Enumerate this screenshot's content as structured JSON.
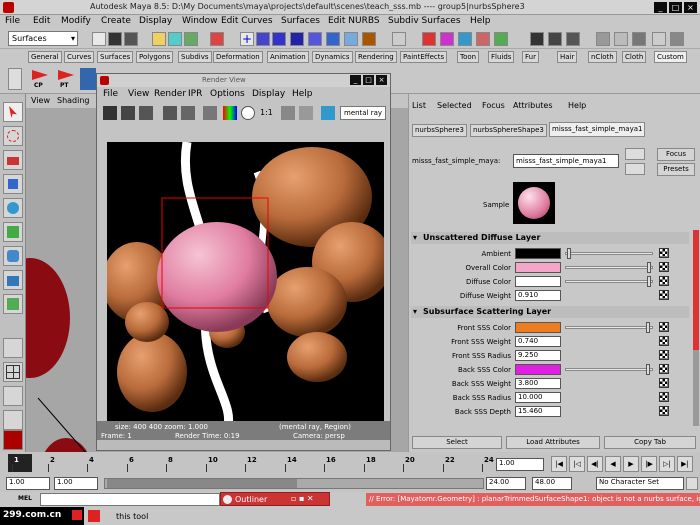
{
  "titlebar": {
    "title": "Autodesk Maya 8.5: D:\\My Documents\\maya\\projects\\default\\scenes\\teach_sss.mb  ----  group5|nurbsSphere3"
  },
  "menubar": [
    "File",
    "Edit",
    "Modify",
    "Create",
    "Display",
    "Window",
    "Edit Curves",
    "Surfaces",
    "Edit NURBS",
    "Subdiv Surfaces",
    "Help"
  ],
  "toolbar": {
    "menuset": "Surfaces"
  },
  "shelf_tabs": [
    "General",
    "Curves",
    "Surfaces",
    "Polygons",
    "Subdivs",
    "Deformation",
    "Animation",
    "Dynamics",
    "Rendering",
    "PaintEffects",
    "Toon",
    "Fluids",
    "Fur",
    "Hair",
    "nCloth",
    "Cloth",
    "Custom"
  ],
  "shelf_icons": [
    {
      "label": "CP"
    },
    {
      "label": "PT"
    }
  ],
  "viewport": {
    "menu": [
      "View",
      "Shading"
    ]
  },
  "render_view": {
    "title": "Render View",
    "menu": [
      "File",
      "View",
      "Render",
      "IPR",
      "Options",
      "Display",
      "Help"
    ],
    "ratio": "1:1",
    "renderer": "mental ray",
    "status": {
      "size": "size:  400  400 zoom: 1.000",
      "renderer_region": "(mental ray, Region)",
      "frame": "Frame: 1",
      "time": "Render Time: 0:19",
      "camera": "Camera: persp"
    }
  },
  "attr_editor": {
    "menu": [
      "List",
      "Selected",
      "Focus",
      "Attributes",
      "Help"
    ],
    "tabs": [
      "nurbsSphere3",
      "nurbsSphereShape3",
      "misss_fast_simple_maya1"
    ],
    "node_label": "misss_fast_simple_maya:",
    "node_value": "misss_fast_simple_maya1",
    "focus_label": "Focus",
    "presets_label": "Presets",
    "sample_label": "Sample",
    "sections": [
      {
        "title": "Unscattered Diffuse Layer",
        "rows": [
          {
            "label": "Ambient",
            "type": "color",
            "color": "#000000",
            "slider": 0.02
          },
          {
            "label": "Overall Color",
            "type": "color",
            "color": "#f4a6c8",
            "slider": 0.98
          },
          {
            "label": "Diffuse Color",
            "type": "color",
            "color": "#ffffff",
            "slider": 0.98
          },
          {
            "label": "Diffuse Weight",
            "type": "value",
            "value": "0.910"
          }
        ]
      },
      {
        "title": "Subsurface Scattering Layer",
        "rows": [
          {
            "label": "Front SSS Color",
            "type": "color",
            "color": "#f07c20",
            "slider": 0.97
          },
          {
            "label": "Front SSS Weight",
            "type": "value",
            "value": "0.740"
          },
          {
            "label": "Front SSS Radius",
            "type": "value",
            "value": "9.250"
          },
          {
            "label": "Back SSS Color",
            "type": "color",
            "color": "#e020e0",
            "slider": 0.97
          },
          {
            "label": "Back SSS Weight",
            "type": "value",
            "value": "3.800"
          },
          {
            "label": "Back SSS Radius",
            "type": "value",
            "value": "10.000"
          },
          {
            "label": "Back SSS Depth",
            "type": "value",
            "value": "15.460"
          }
        ]
      }
    ],
    "buttons": [
      "Select",
      "Load Attributes",
      "Copy Tab"
    ]
  },
  "timeline": {
    "ticks": [
      "1",
      "2",
      "4",
      "6",
      "8",
      "10",
      "12",
      "14",
      "16",
      "18",
      "20",
      "22",
      "24"
    ],
    "current": "1.00"
  },
  "range": {
    "start": "1.00",
    "start2": "1.00",
    "end": "24.00",
    "end2": "48.00",
    "character_set": "No Character Set"
  },
  "cmdline": {
    "label": "MEL",
    "error": "// Error: [Mayatomr.Geometry] : planarTrimmedSurfaceShape1: object is not a nurbs surface, igno"
  },
  "outliner": {
    "title": "Outliner"
  },
  "helpline": {
    "text": "this tool",
    "watermark": "299.com.cn"
  }
}
